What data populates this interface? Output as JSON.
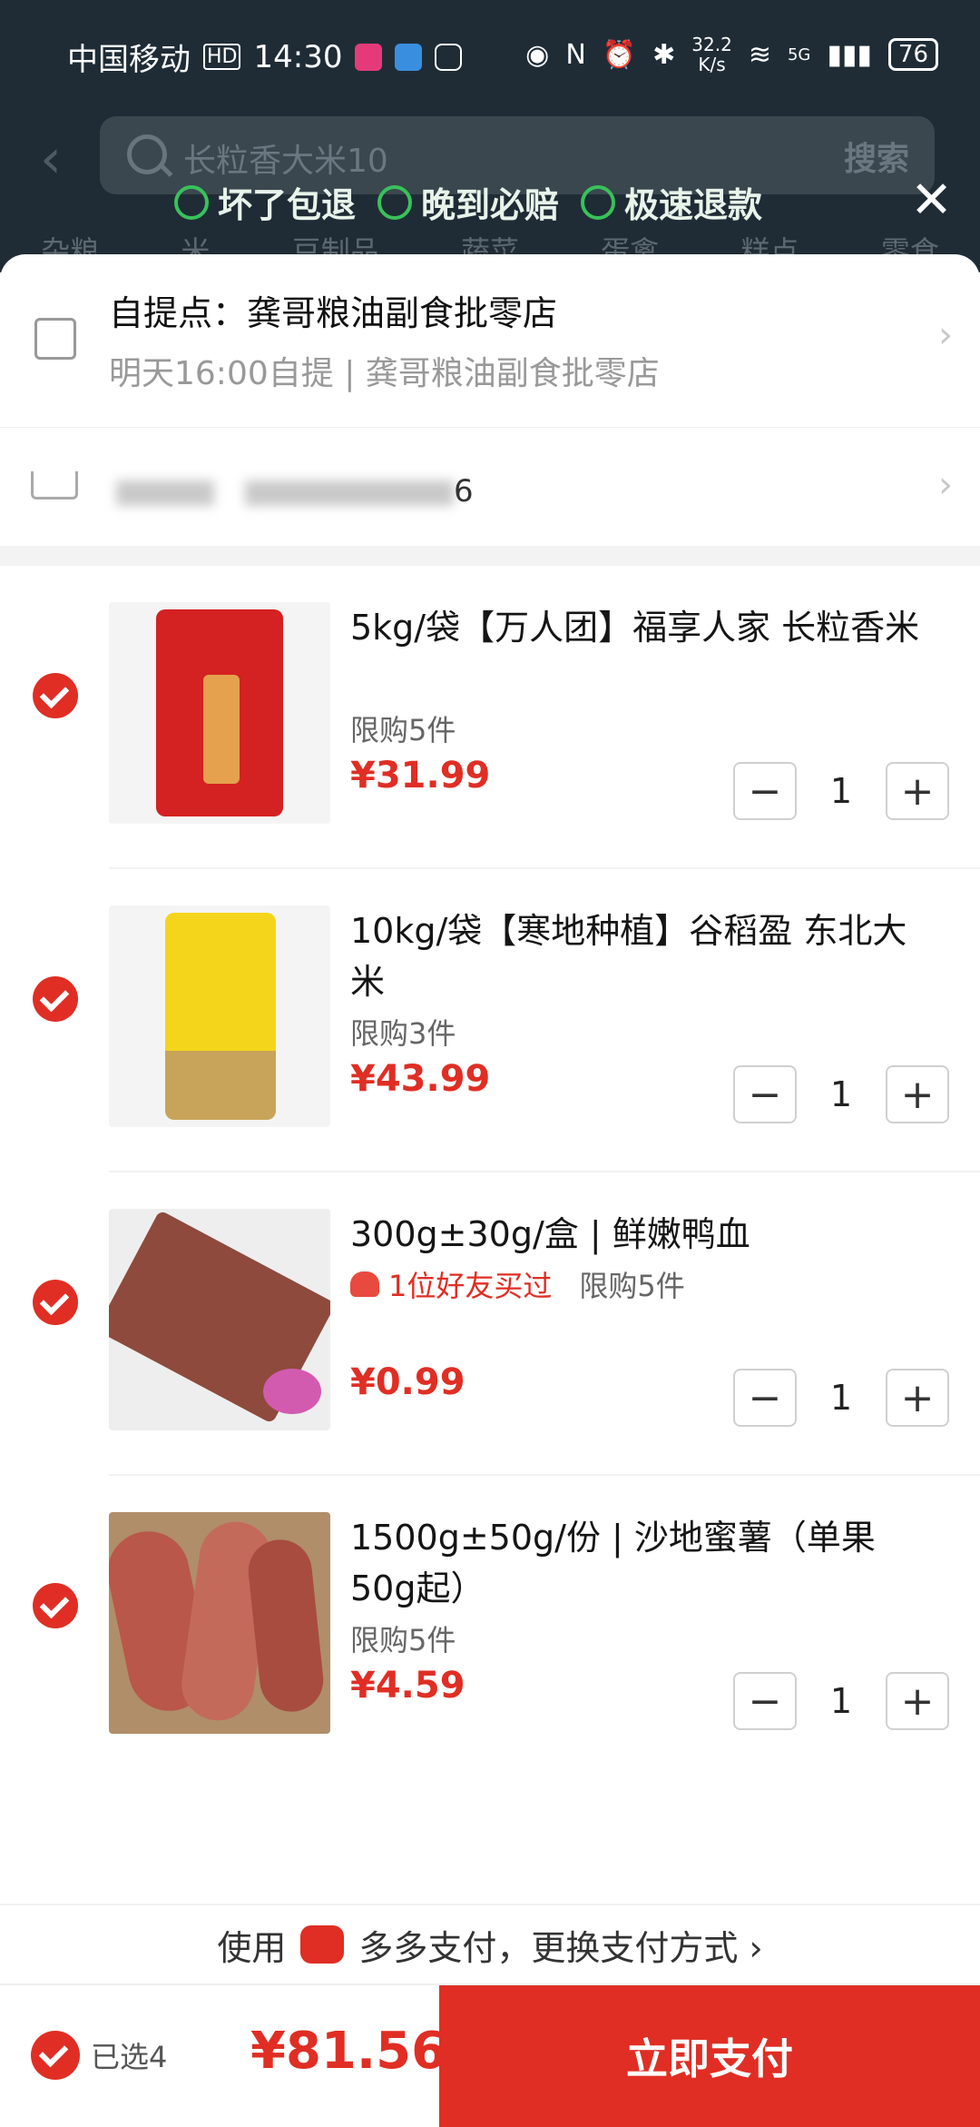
{
  "status": {
    "carrier": "中国移动",
    "hd": "HD",
    "time": "14:30",
    "speed_value": "32.2",
    "speed_unit": "K/s",
    "network": "5G",
    "battery": "76"
  },
  "search": {
    "query": "长粒香大米10",
    "button": "搜索"
  },
  "guarantees": [
    "坏了包退",
    "晚到必赔",
    "极速退款"
  ],
  "categories": [
    "杂粮",
    "米",
    "豆制品",
    "蔬菜",
    "蛋禽",
    "糕点",
    "零食"
  ],
  "pickup": {
    "title": "自提点：龚哥粮油副食批零店",
    "subtitle": "明天16:00自提 | 龚哥粮油副食批零店"
  },
  "address": {
    "suffix": "6"
  },
  "items": [
    {
      "title": "5kg/袋【万人团】福享人家 长粒香米",
      "limit": "限购5件",
      "price": "¥31.99",
      "qty": "1"
    },
    {
      "title": "10kg/袋【寒地种植】谷稻盈 东北大米",
      "limit": "限购3件",
      "price": "¥43.99",
      "qty": "1"
    },
    {
      "title": "300g±30g/盒 | 鲜嫩鸭血",
      "friend": "1位好友买过",
      "limit": "限购5件",
      "price": "¥0.99",
      "qty": "1"
    },
    {
      "title": "1500g±50g/份 | 沙地蜜薯（单果50g起）",
      "limit": "限购5件",
      "price": "¥4.59",
      "qty": "1"
    }
  ],
  "stepper": {
    "minus": "−",
    "plus": "+"
  },
  "payment_hint": {
    "prefix": "使用",
    "method": "多多支付，更换支付方式 ›"
  },
  "bottom": {
    "selected": "已选4",
    "total": "¥81.56",
    "pay_button": "立即支付"
  },
  "colors": {
    "accent": "#e02e24",
    "top_bg": "#1f2c36",
    "green": "#39c15a"
  }
}
